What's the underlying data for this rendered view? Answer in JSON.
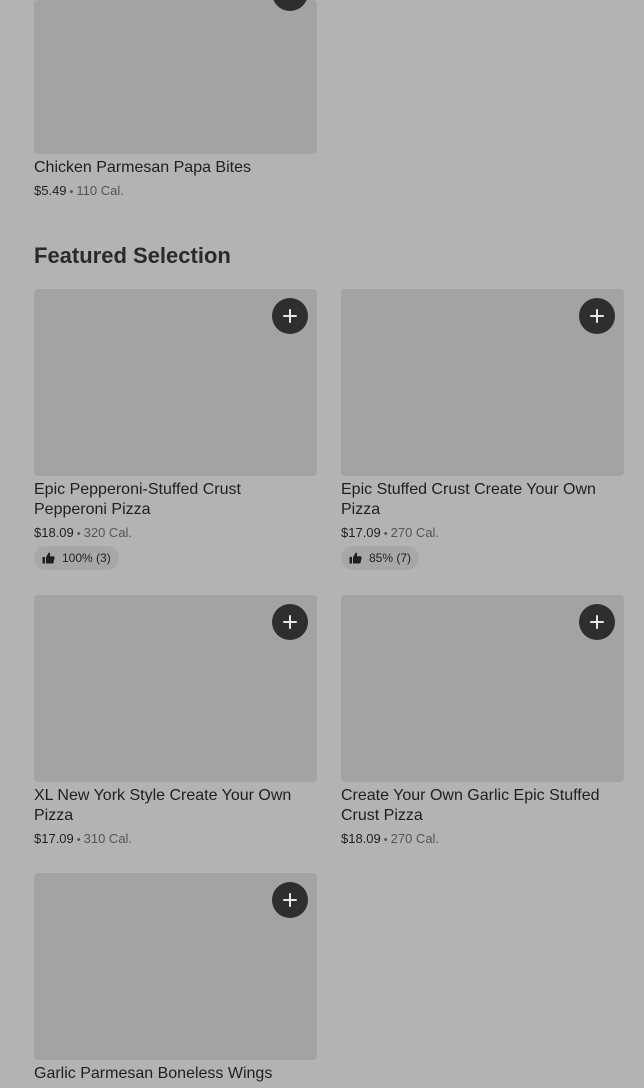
{
  "top_item": {
    "name": "Chicken Parmesan Papa Bites",
    "price": "$5.49",
    "calories": "110 Cal."
  },
  "section": {
    "title": "Featured Selection"
  },
  "items": [
    {
      "name": "Epic Pepperoni-Stuffed Crust Pepperoni Pizza",
      "price": "$18.09",
      "calories": "320 Cal.",
      "rating": "100% (3)"
    },
    {
      "name": "Epic Stuffed Crust Create Your Own Pizza",
      "price": "$17.09",
      "calories": "270 Cal.",
      "rating": "85% (7)"
    },
    {
      "name": "XL New York Style Create Your Own Pizza",
      "price": "$17.09",
      "calories": "310 Cal."
    },
    {
      "name": "Create Your Own Garlic Epic Stuffed Crust Pizza",
      "price": "$18.09",
      "calories": "270 Cal."
    },
    {
      "name": "Garlic Parmesan Boneless Wings"
    }
  ],
  "icons": {
    "add": "plus-icon",
    "rating": "thumbs-up-icon"
  },
  "colors": {
    "background": "#b3b3b3",
    "image_placeholder": "#a3a3a3",
    "button": "#2e2e2e"
  }
}
